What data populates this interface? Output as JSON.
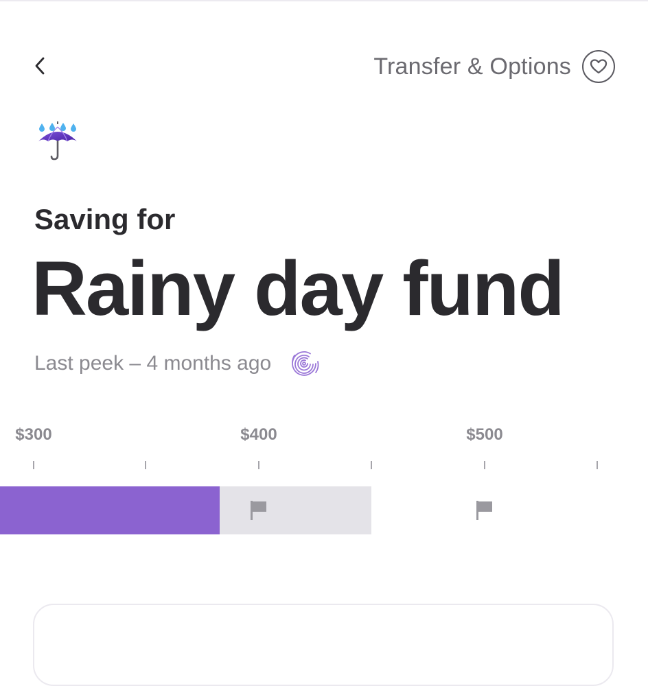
{
  "header": {
    "back_icon": "chevron-left-icon",
    "transfer_options_label": "Transfer & Options",
    "favorite_icon": "heart-icon"
  },
  "goal": {
    "icon": "umbrella-with-rain-drops-icon",
    "subtitle": "Saving for",
    "title": "Rainy day fund",
    "last_peek": "Last peek – 4 months ago",
    "peek_icon": "fingerprint-icon"
  },
  "progress": {
    "scale_labels": [
      "$300",
      "$400",
      "$500"
    ],
    "saved_color": "#8b63d0",
    "remaining_color": "#e4e3e8",
    "milestone_icons": [
      "flag-icon",
      "flag-icon"
    ]
  }
}
